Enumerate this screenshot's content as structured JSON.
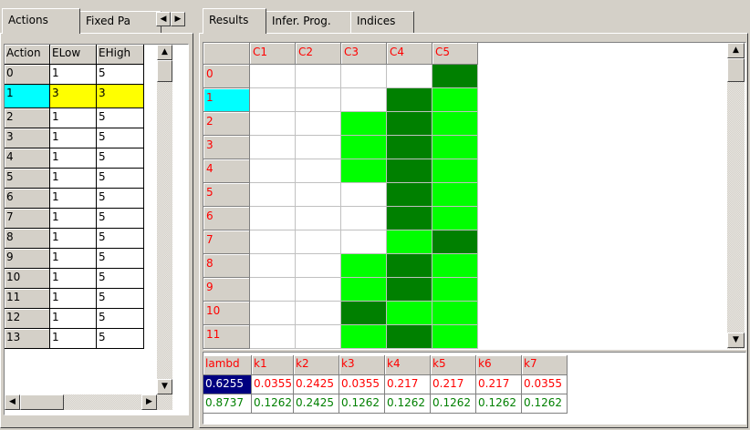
{
  "left_panel": {
    "tabs": [
      "Actions",
      "Fixed Pa"
    ],
    "grid": {
      "headers": [
        "Action",
        "ELow",
        "EHigh"
      ],
      "rows": [
        [
          "0",
          "1",
          "5"
        ],
        [
          "1",
          "3",
          "3"
        ],
        [
          "2",
          "1",
          "5"
        ],
        [
          "3",
          "1",
          "5"
        ],
        [
          "4",
          "1",
          "5"
        ],
        [
          "5",
          "1",
          "5"
        ],
        [
          "6",
          "1",
          "5"
        ],
        [
          "7",
          "1",
          "5"
        ],
        [
          "8",
          "1",
          "5"
        ],
        [
          "9",
          "1",
          "5"
        ],
        [
          "10",
          "1",
          "5"
        ],
        [
          "11",
          "1",
          "5"
        ],
        [
          "12",
          "1",
          "5"
        ],
        [
          "13",
          "1",
          "5"
        ]
      ],
      "selected_row": 1
    }
  },
  "right_panel": {
    "tabs": [
      "Results",
      "Infer. Prog.",
      "Indices"
    ],
    "results_grid": {
      "columns": [
        "C1",
        "C2",
        "C3",
        "C4",
        "C5"
      ],
      "rows": [
        "0",
        "1",
        "2",
        "3",
        "4",
        "5",
        "6",
        "7",
        "8",
        "9",
        "10",
        "11"
      ],
      "cells": [
        [
          "w",
          "w",
          "w",
          "w",
          "d"
        ],
        [
          "w",
          "w",
          "w",
          "d",
          "l"
        ],
        [
          "w",
          "w",
          "l",
          "d",
          "l"
        ],
        [
          "w",
          "w",
          "l",
          "d",
          "l"
        ],
        [
          "w",
          "w",
          "l",
          "d",
          "l"
        ],
        [
          "w",
          "w",
          "w",
          "d",
          "l"
        ],
        [
          "w",
          "w",
          "w",
          "d",
          "l"
        ],
        [
          "w",
          "w",
          "w",
          "l",
          "d"
        ],
        [
          "w",
          "w",
          "l",
          "d",
          "l"
        ],
        [
          "w",
          "w",
          "l",
          "d",
          "l"
        ],
        [
          "w",
          "w",
          "d",
          "l",
          "l"
        ],
        [
          "w",
          "w",
          "l",
          "d",
          "l"
        ]
      ],
      "colors": {
        "w": "#ffffff",
        "l": "#00ff00",
        "d": "#008000"
      }
    },
    "lambda_grid": {
      "headers": [
        "lambd",
        "k1",
        "k2",
        "k3",
        "k4",
        "k5",
        "k6",
        "k7"
      ],
      "row1": [
        "0.6255",
        "0.0355",
        "0.2425",
        "0.0355",
        "0.217",
        "0.217",
        "0.217",
        "0.0355"
      ],
      "row2": [
        "0.8737",
        "0.1262",
        "0.2425",
        "0.1262",
        "0.1262",
        "0.1262",
        "0.1262",
        "0.1262"
      ]
    }
  }
}
